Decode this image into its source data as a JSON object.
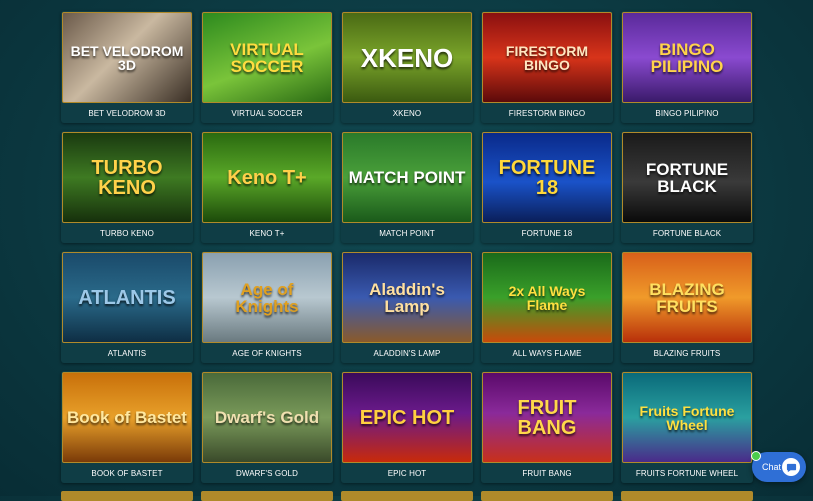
{
  "games": [
    {
      "name": "BET VELODROM 3D",
      "art": "BET VELODROM 3D",
      "bg": "linear-gradient(135deg,#6b5a4a,#c9b8a0 45%,#3a2f25)",
      "fg": "#ffffff",
      "accent": "#d42020"
    },
    {
      "name": "VIRTUAL SOCCER",
      "art": "VIRTUAL SOCCER",
      "bg": "linear-gradient(160deg,#2d8a1e,#7ac43a 55%,#2b6b14)",
      "fg": "#ffdc40",
      "accent": "#ffffff"
    },
    {
      "name": "XKENO",
      "art": "XKENO",
      "bg": "linear-gradient(180deg,#4a6a14,#7aa42a 50%,#3b5a10)",
      "fg": "#ffffff",
      "accent": "#f5d23a"
    },
    {
      "name": "FIRESTORM BINGO",
      "art": "FIRESTORM BINGO",
      "bg": "linear-gradient(180deg,#8a1010,#d8341a 50%,#5c0a0a)",
      "fg": "#ffe6c0",
      "accent": "#ffffff"
    },
    {
      "name": "BINGO PILIPINO",
      "art": "BINGO PILIPINO",
      "bg": "linear-gradient(180deg,#5a2a9a,#8a4ad0 50%,#3a1a6a)",
      "fg": "#ffd34a",
      "accent": "#ffffff"
    },
    {
      "name": "TURBO KENO",
      "art": "TURBO KENO",
      "bg": "linear-gradient(180deg,#1a3a10,#3e7a22 50%,#16300c)",
      "fg": "#ffd24a",
      "accent": "#ffffff"
    },
    {
      "name": "KENO T+",
      "art": "Keno T+",
      "bg": "linear-gradient(180deg,#2a6a10,#5aa828 50%,#1c4a0a)",
      "fg": "#ffd04a",
      "accent": "#ffffff"
    },
    {
      "name": "MATCH POINT",
      "art": "MATCH POINT",
      "bg": "linear-gradient(180deg,#2a7a2a,#4aa03a 50%,#1a5a1a)",
      "fg": "#ffffff",
      "accent": "#e8b820"
    },
    {
      "name": "FORTUNE 18",
      "art": "FORTUNE 18",
      "bg": "linear-gradient(180deg,#0a2a8a,#1a52c8 55%,#0a1f5a)",
      "fg": "#ffd83a",
      "accent": "#ffffff"
    },
    {
      "name": "FORTUNE BLACK",
      "art": "FORTUNE BLACK",
      "bg": "linear-gradient(180deg,#1a1a1a,#3a3a3a 55%,#0a0a0a)",
      "fg": "#ffffff",
      "accent": "#c82020"
    },
    {
      "name": "ATLANTIS",
      "art": "ATLANTIS",
      "bg": "linear-gradient(180deg,#1a4a6a,#2a6a8a 50%,#0e2e44)",
      "fg": "#9cc8e8",
      "accent": "#ffffff"
    },
    {
      "name": "AGE OF KNIGHTS",
      "art": "Age of Knights",
      "bg": "linear-gradient(180deg,#8aa0b0,#b8c8d0 50%,#6a7a80)",
      "fg": "#e0a020",
      "accent": "#ffffff"
    },
    {
      "name": "ALADDIN'S LAMP",
      "art": "Aladdin's Lamp",
      "bg": "linear-gradient(180deg,#1a2a6a,#3a5ab0 50%,#8a5a2a)",
      "fg": "#ffe0a0",
      "accent": "#ffffff"
    },
    {
      "name": "ALL WAYS FLAME",
      "art": "2x All Ways Flame",
      "bg": "linear-gradient(180deg,#1a6a1a,#3aa02a 50%,#c84a0a)",
      "fg": "#ffe040",
      "accent": "#ffffff"
    },
    {
      "name": "BLAZING FRUITS",
      "art": "BLAZING FRUITS",
      "bg": "linear-gradient(180deg,#d8601a,#f09a2a 50%,#b8300a)",
      "fg": "#ffe060",
      "accent": "#ffffff"
    },
    {
      "name": "BOOK OF BASTET",
      "art": "Book of Bastet",
      "bg": "linear-gradient(180deg,#c8700a,#e8a02a 50%,#7a3a08)",
      "fg": "#ffe8a0",
      "accent": "#ffffff"
    },
    {
      "name": "DWARF'S GOLD",
      "art": "Dwarf's Gold",
      "bg": "linear-gradient(180deg,#4a6a3a,#7a9a5a 50%,#3a4a2a)",
      "fg": "#f0e0b0",
      "accent": "#ffffff"
    },
    {
      "name": "EPIC HOT",
      "art": "EPIC HOT",
      "bg": "linear-gradient(180deg,#3a0a5a,#6a1a8a 45%,#c82a0a)",
      "fg": "#ffd040",
      "accent": "#ffffff"
    },
    {
      "name": "FRUIT BANG",
      "art": "FRUIT BANG",
      "bg": "linear-gradient(180deg,#5a0a6a,#8a2a9a 45%,#c8301a)",
      "fg": "#ffd84a",
      "accent": "#ffffff"
    },
    {
      "name": "FRUITS FORTUNE WHEEL",
      "art": "Fruits Fortune Wheel",
      "bg": "linear-gradient(180deg,#0a6a7a,#2aa0a0 50%,#4a2a8a)",
      "fg": "#ffe040",
      "accent": "#ffffff"
    }
  ],
  "chat": {
    "label": "Chat",
    "button_color": "#2f6fd6",
    "online_color": "#4ccc4c"
  }
}
